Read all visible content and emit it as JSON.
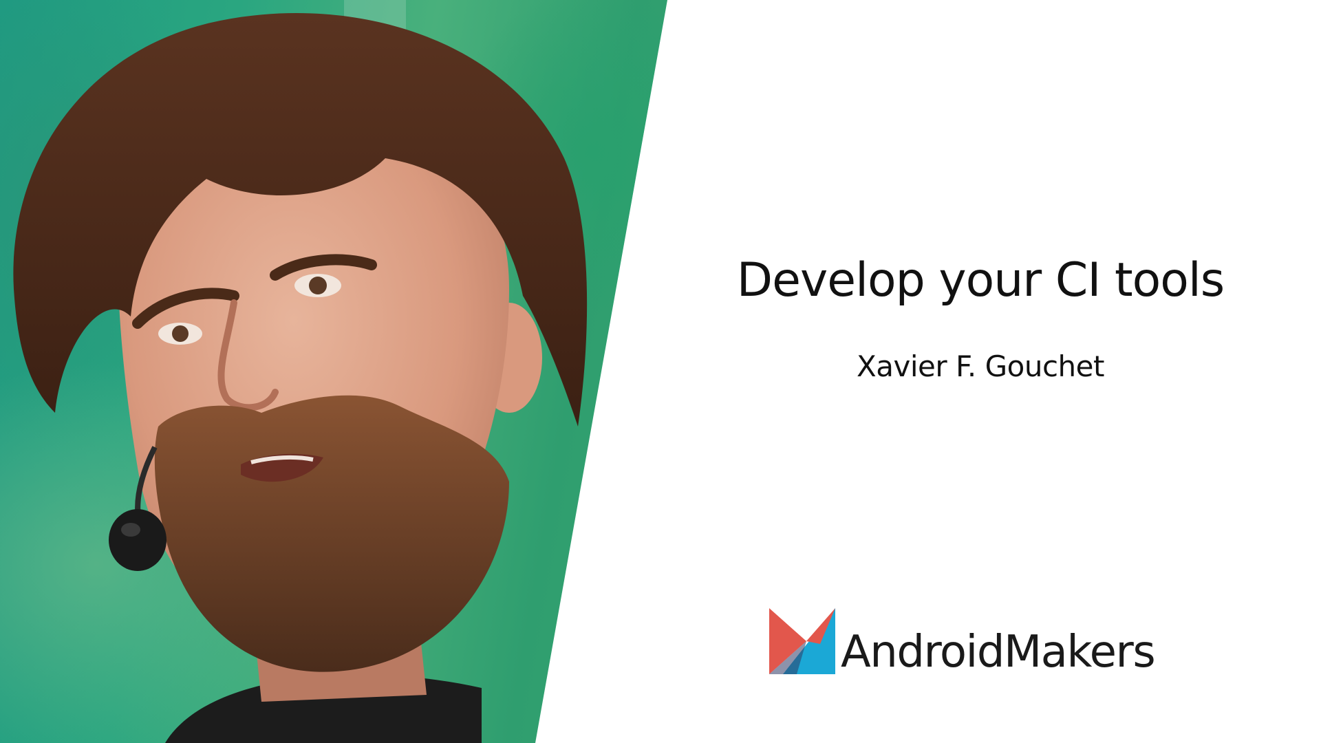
{
  "slide": {
    "title": "Develop your CI tools",
    "speaker": "Xavier F. Gouchet"
  },
  "brand": {
    "name": "AndroidMakers",
    "logo_icon": "android-makers-logo-icon",
    "colors": {
      "red": "#e2574c",
      "blue": "#1ba8d6"
    }
  },
  "photo": {
    "icon": "speaker-photo",
    "background_color": "#2aa680"
  }
}
